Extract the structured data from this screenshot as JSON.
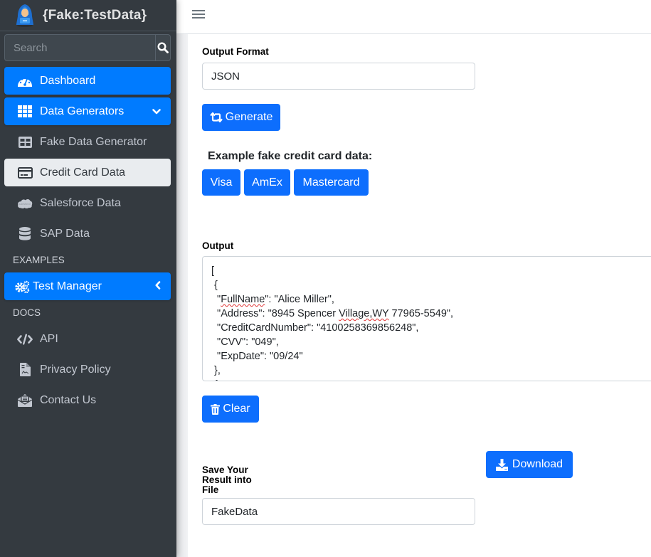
{
  "brand": {
    "name": "{Fake:TestData}"
  },
  "search": {
    "placeholder": "Search"
  },
  "sidebar": {
    "items": [
      {
        "label": "Dashboard"
      },
      {
        "label": "Data Generators"
      },
      {
        "label": "Fake Data Generator"
      },
      {
        "label": "Credit Card Data"
      },
      {
        "label": "Salesforce Data"
      },
      {
        "label": "SAP Data"
      }
    ],
    "examples_header": "EXAMPLES",
    "examples": [
      {
        "label": "Test Manager"
      }
    ],
    "docs_header": "DOCS",
    "docs": [
      {
        "label": "API"
      },
      {
        "label": "Privacy Policy"
      },
      {
        "label": "Contact Us"
      }
    ]
  },
  "form": {
    "output_format_label": "Output Format",
    "output_format_value": "JSON",
    "generate_label": "Generate",
    "examples_heading": "Example fake credit card data:",
    "card_buttons": [
      "Visa",
      "AmEx",
      "Mastercard"
    ],
    "output_label": "Output",
    "output_lines": [
      "[",
      " {",
      "  \"FullName\": \"Alice Miller\",",
      "  \"Address\": \"8945 Spencer Village,WY 77965-5549\",",
      "  \"CreditCardNumber\": \"4100258369856248\",",
      "  \"CVV\": \"049\",",
      "  \"ExpDate\": \"09/24\"",
      " },",
      " {"
    ],
    "clear_label": "Clear",
    "save_label": "Save Your Result into File",
    "save_line1": "Save Your",
    "save_line2": "Result into",
    "save_line3": "File",
    "filename_value": "FakeData",
    "download_label": "Download"
  },
  "colors": {
    "primary": "#0d6efd",
    "sidebar_active": "#007bff",
    "sidebar_bg": "#343a40"
  }
}
